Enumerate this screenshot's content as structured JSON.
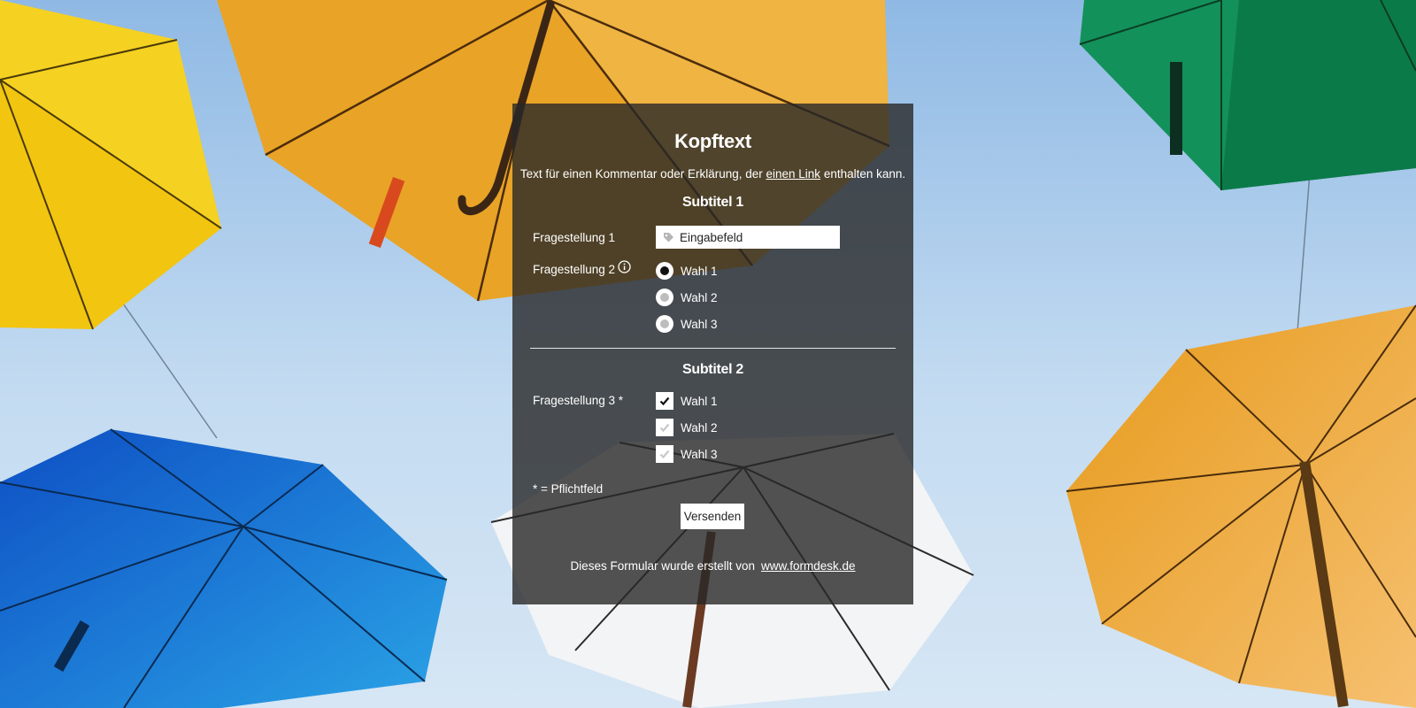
{
  "form": {
    "title": "Kopftext",
    "intro_before": "Text für einen Kommentar oder Erklärung, der ",
    "intro_link": "einen Link",
    "intro_after": " enthalten kann.",
    "subtitle_1": "Subtitel 1",
    "question_1": {
      "label": "Fragestellung 1",
      "placeholder": "Eingabefeld",
      "icon": "tag-icon"
    },
    "question_2": {
      "label": "Fragestellung 2",
      "info_icon": "info-icon",
      "options": [
        {
          "label": "Wahl 1",
          "selected": true
        },
        {
          "label": "Wahl 2",
          "selected": false
        },
        {
          "label": "Wahl 3",
          "selected": false
        }
      ]
    },
    "subtitle_2": "Subtitel 2",
    "question_3": {
      "label": "Fragestellung 3 *",
      "options": [
        {
          "label": "Wahl 1",
          "checked": true
        },
        {
          "label": "Wahl 2",
          "checked": false
        },
        {
          "label": "Wahl 3",
          "checked": false
        }
      ]
    },
    "required_note": "* = Pflichtfeld",
    "submit_label": "Versenden",
    "footer_text": "Dieses Formular wurde erstellt von",
    "footer_link": "www.formdesk.de"
  },
  "colors": {
    "panel_background": "#282828",
    "text": "#ffffff",
    "sky": "#bcd6ef"
  }
}
